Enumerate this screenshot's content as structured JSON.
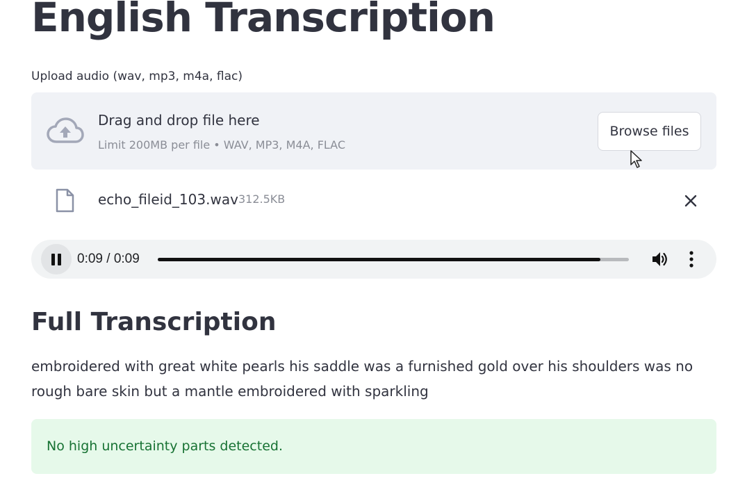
{
  "page": {
    "title": "English Transcription"
  },
  "uploader": {
    "label": "Upload audio (wav, mp3, m4a, flac)",
    "drag_text": "Drag and drop file here",
    "limit_text": "Limit 200MB per file • WAV, MP3, M4A, FLAC",
    "browse_label": "Browse files",
    "icon": "cloud-upload-icon"
  },
  "file": {
    "name": "echo_fileid_103.wav",
    "size": "312.5KB",
    "icon": "file-icon",
    "remove_icon": "close-icon"
  },
  "audio_player": {
    "time": "0:09 / 0:09",
    "played_fraction": 0.94,
    "state": "playing",
    "icons": [
      "pause-icon",
      "volume-icon",
      "more-vertical-icon"
    ]
  },
  "transcription": {
    "heading": "Full Transcription",
    "text": "embroidered with great white pearls his saddle was a furnished gold over his shoulders was no rough bare skin but a mantle embroidered with sparkling"
  },
  "status": {
    "message": "No high uncertainty parts detected.",
    "color": "#177233",
    "background": "#e6f9ea"
  }
}
